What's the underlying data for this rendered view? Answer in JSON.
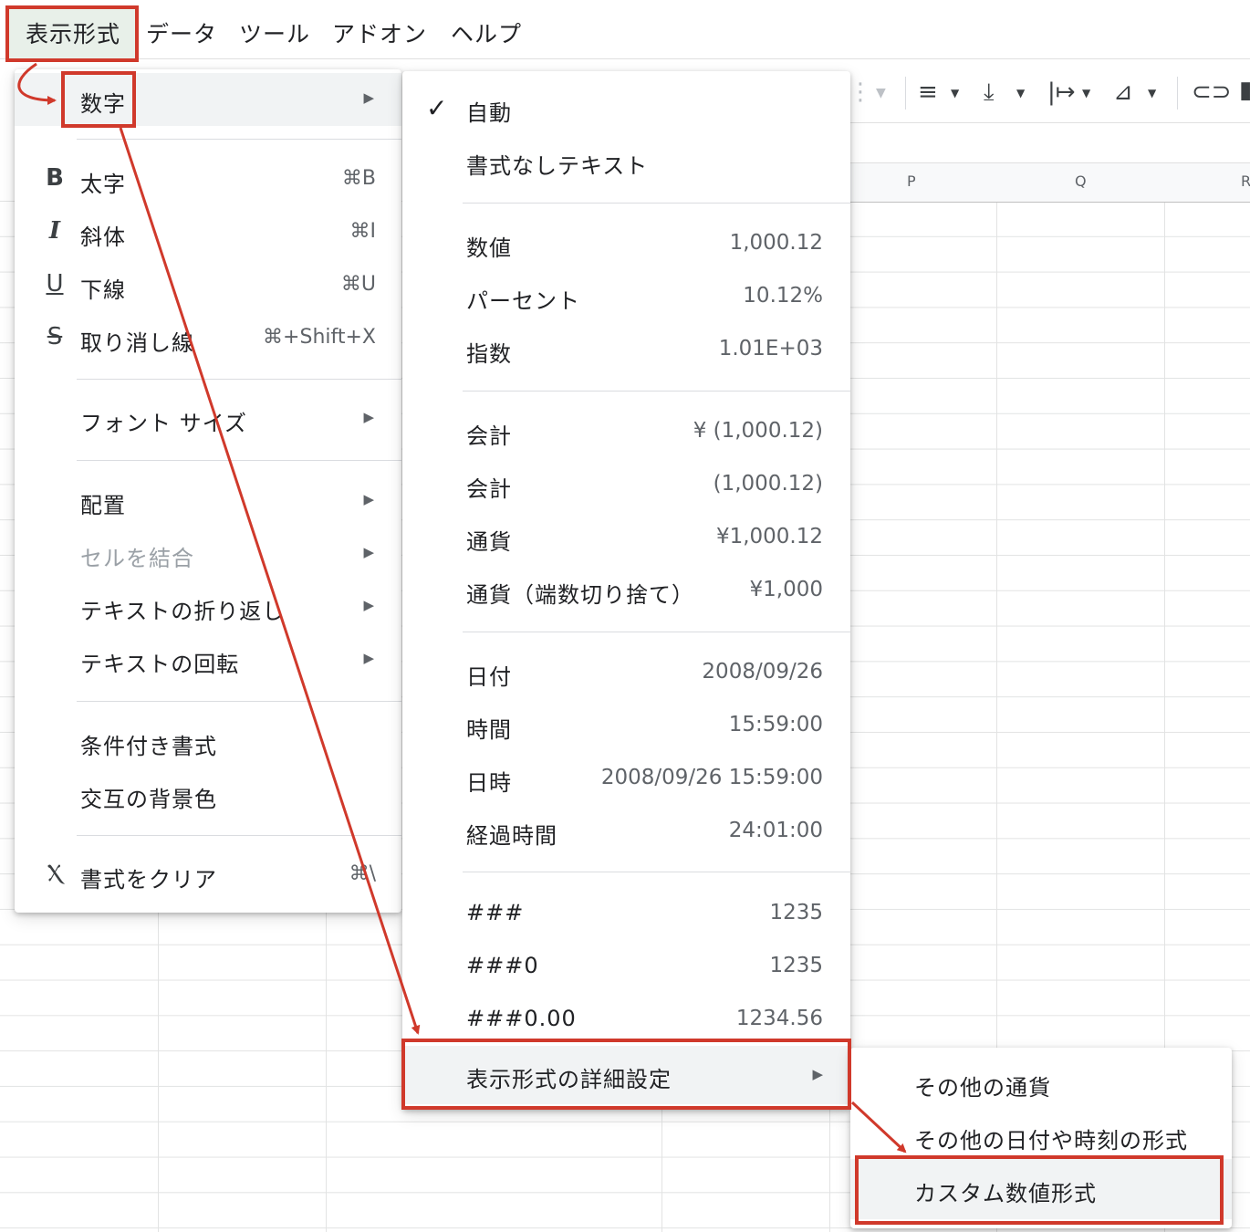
{
  "menubar": {
    "items": [
      "表示形式",
      "データ",
      "ツール",
      "アドオン",
      "ヘルプ"
    ]
  },
  "columns": [
    "P",
    "Q",
    "R"
  ],
  "format_menu": {
    "items": [
      {
        "label": "数字",
        "arrow": "▶",
        "icon": "",
        "shortcut": ""
      },
      {
        "label": "太字",
        "icon": "B",
        "shortcut": "⌘B"
      },
      {
        "label": "斜体",
        "icon": "I",
        "shortcut": "⌘I"
      },
      {
        "label": "下線",
        "icon": "U",
        "shortcut": "⌘U"
      },
      {
        "label": "取り消し線",
        "icon": "S",
        "shortcut": "⌘+Shift+X"
      },
      {
        "label": "フォント サイズ",
        "arrow": "▶"
      },
      {
        "label": "配置",
        "arrow": "▶"
      },
      {
        "label": "セルを結合",
        "arrow": "▶",
        "disabled": true
      },
      {
        "label": "テキストの折り返し",
        "arrow": "▶"
      },
      {
        "label": "テキストの回転",
        "arrow": "▶"
      },
      {
        "label": "条件付き書式"
      },
      {
        "label": "交互の背景色"
      },
      {
        "label": "書式をクリア",
        "icon": "clear-format",
        "shortcut": "⌘\\"
      }
    ]
  },
  "number_menu": {
    "check": "✓",
    "items": [
      {
        "label": "自動",
        "value": "",
        "checked": true
      },
      {
        "label": "書式なしテキスト",
        "value": ""
      },
      {
        "label": "数値",
        "value": "1,000.12"
      },
      {
        "label": "パーセント",
        "value": "10.12%"
      },
      {
        "label": "指数",
        "value": "1.01E+03"
      },
      {
        "label": "会計",
        "value": "¥ (1,000.12)"
      },
      {
        "label": "会計",
        "value": "(1,000.12)"
      },
      {
        "label": "通貨",
        "value": "¥1,000.12"
      },
      {
        "label": "通貨（端数切り捨て）",
        "value": "¥1,000"
      },
      {
        "label": "日付",
        "value": "2008/09/26"
      },
      {
        "label": "時間",
        "value": "15:59:00"
      },
      {
        "label": "日時",
        "value": "2008/09/26 15:59:00"
      },
      {
        "label": "経過時間",
        "value": "24:01:00"
      },
      {
        "label": "###",
        "value": "1235"
      },
      {
        "label": "###0",
        "value": "1235"
      },
      {
        "label": "###0.00",
        "value": "1234.56"
      },
      {
        "label": "表示形式の詳細設定",
        "arrow": "▶"
      }
    ]
  },
  "more_formats_menu": {
    "items": [
      {
        "label": "その他の通貨"
      },
      {
        "label": "その他の日付や時刻の形式"
      },
      {
        "label": "カスタム数値形式"
      }
    ]
  },
  "colors": {
    "annotation": "#d0392b",
    "highlight": "#f1f3f4",
    "menu_active": "#e8f0e9"
  }
}
